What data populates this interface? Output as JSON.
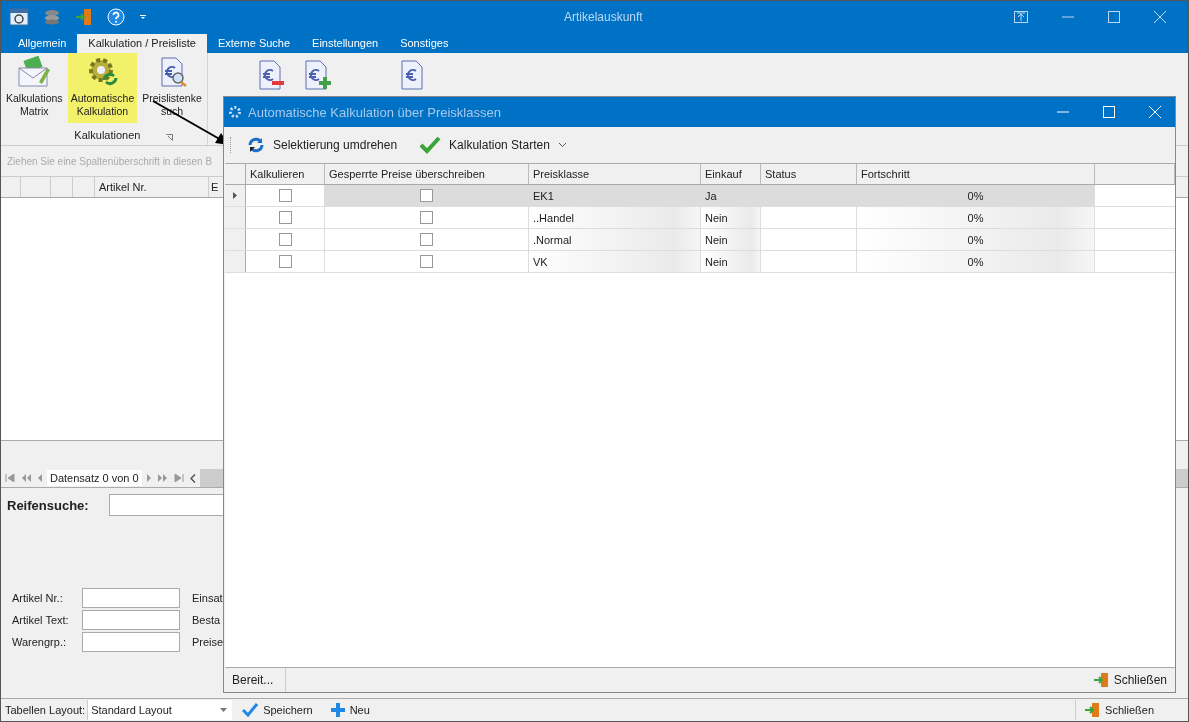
{
  "window": {
    "title": "Artikelauskunft"
  },
  "ribbon_tabs": [
    {
      "label": "Allgemein",
      "selected": false
    },
    {
      "label": "Kalkulation / Preisliste",
      "selected": true
    },
    {
      "label": "Externe Suche",
      "selected": false
    },
    {
      "label": "Einstellungen",
      "selected": false
    },
    {
      "label": "Sonstiges",
      "selected": false
    }
  ],
  "ribbon": {
    "buttons": [
      {
        "lines": [
          "Kalkulations",
          "Matrix"
        ],
        "highlighted": false
      },
      {
        "lines": [
          "Automatische",
          "Kalkulation"
        ],
        "highlighted": true
      },
      {
        "lines": [
          "Preislistenke",
          "such"
        ],
        "highlighted": false
      }
    ],
    "group_label": "Kalkulationen"
  },
  "group_bar": {
    "text": "Ziehen Sie eine Spaltenüberschrift in diesen B"
  },
  "grid": {
    "columns": [
      "Artikel Nr.",
      "E"
    ]
  },
  "navigator": {
    "record_text": "Datensatz 0 von 0"
  },
  "tire_search": {
    "label": "Reifensuche:"
  },
  "fields": [
    {
      "label": "Artikel Nr.:"
    },
    {
      "label": "Artikel Text:"
    },
    {
      "label": "Warengrp.:"
    }
  ],
  "side_labels": [
    "Einsat",
    "Besta",
    "Preise"
  ],
  "bottom_bar": {
    "layout_label": "Tabellen Layout:",
    "layout_value": "Standard Layout",
    "save": "Speichern",
    "new": "Neu",
    "close": "Schließen"
  },
  "dialog": {
    "title": "Automatische Kalkulation über Preisklassen",
    "toolbar": {
      "invert": "Selektierung umdrehen",
      "start": "Kalkulation Starten"
    },
    "columns": [
      "Kalkulieren",
      "Gesperrte Preise überschreiben",
      "Preisklasse",
      "Einkauf",
      "Status",
      "Fortschritt"
    ],
    "rows": [
      {
        "selected": true,
        "calculate": false,
        "overwrite": false,
        "price_class": "EK1",
        "purchase": "Ja",
        "progress": "0%"
      },
      {
        "selected": false,
        "calculate": false,
        "overwrite": false,
        "price_class": "..Handel",
        "purchase": "Nein",
        "progress": "0%"
      },
      {
        "selected": false,
        "calculate": false,
        "overwrite": false,
        "price_class": ".Normal",
        "purchase": "Nein",
        "progress": "0%"
      },
      {
        "selected": false,
        "calculate": false,
        "overwrite": false,
        "price_class": "VK",
        "purchase": "Nein",
        "progress": "0%"
      }
    ],
    "status": "Bereit...",
    "close": "Schließen"
  }
}
